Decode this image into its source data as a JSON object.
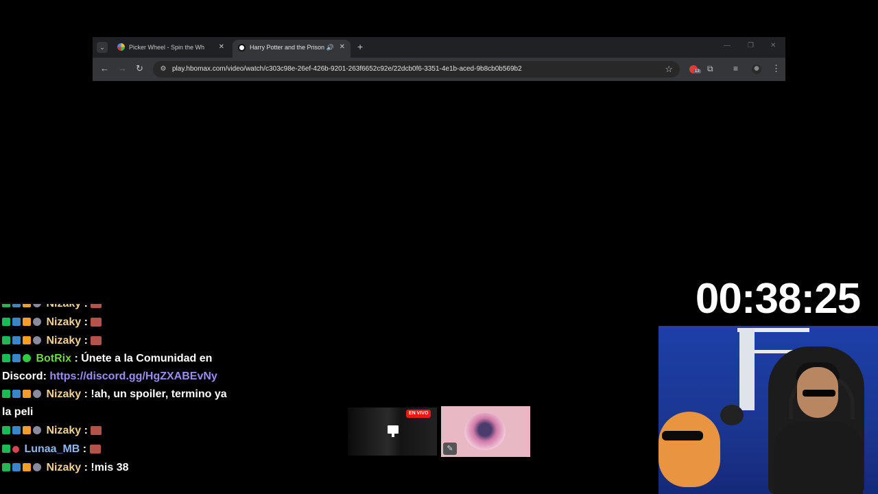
{
  "browser": {
    "tabs": [
      {
        "title": "Picker Wheel - Spin the Wheel t",
        "active": false
      },
      {
        "title": "Harry Potter and the Prison",
        "active": true,
        "audio": true
      }
    ],
    "url": "play.hbomax.com/video/watch/c303c98e-26ef-426b-9201-263f6652c92e/22dcb0f6-3351-4e1b-aced-9b8cb0b569b2",
    "extension_badge": "13"
  },
  "timer": "00:38:25",
  "chat": {
    "messages": [
      {
        "user": "Nizaky",
        "sep": " : ",
        "text": ""
      },
      {
        "user": "Nizaky",
        "sep": " : ",
        "text": ""
      },
      {
        "user": "Nizaky",
        "sep": " : ",
        "text": ""
      },
      {
        "user": "BotRix",
        "sep": " : ",
        "text": "Únete a la Comunidad en Discord: ",
        "link": "https://discord.gg/HgZXABEvNy"
      },
      {
        "user": "Nizaky",
        "sep": " : ",
        "text": "!ah, un spoiler, termino ya la peli"
      },
      {
        "user": "Nizaky",
        "sep": " : ",
        "text": ""
      },
      {
        "user": "Lunaa_MB",
        "sep": " : ",
        "text": ""
      },
      {
        "user": "Nizaky",
        "sep": " : ",
        "text": "!mis 38"
      }
    ]
  },
  "previews": {
    "live_label": "EN VIVO"
  },
  "colors": {
    "nizaky": "#f2d294",
    "botrix": "#6bdc3a",
    "lunaa": "#8fb8ee",
    "link": "#9a8cf2",
    "live_red": "#e91916"
  }
}
